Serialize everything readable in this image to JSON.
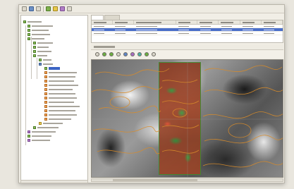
{
  "app": {
    "toolbar_icons": [
      "new-icon",
      "open-icon",
      "save-icon",
      "layer-icon",
      "query-icon",
      "map-icon"
    ]
  },
  "tabs": [
    {
      "label": "",
      "active": true
    },
    {
      "label": "",
      "active": false
    }
  ],
  "table": {
    "columns": 8,
    "rows": 3,
    "highlighted_row": 2
  },
  "map_tools": [
    "pan-icon",
    "zoom-in-icon",
    "zoom-out-icon",
    "select-icon",
    "identify-icon",
    "measure-icon",
    "layer-toggle-icon",
    "draw-icon",
    "refresh-icon"
  ],
  "colors": {
    "accent": "#3b64c4",
    "overlay": "#a4482a",
    "vegetation": "#2f9a3a",
    "contour": "#d98c2a"
  }
}
